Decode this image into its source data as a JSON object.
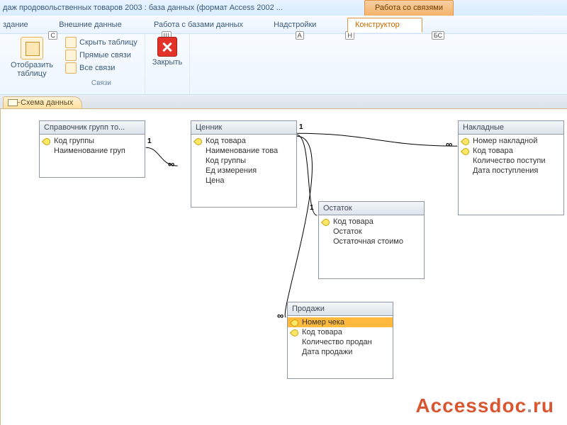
{
  "window_title": "даж продовольственных товаров 2003 : база данных (формат Access 2002 ...",
  "context_tab": "Работа со связями",
  "main_tabs": {
    "t1": "здание",
    "t2": "Внешние данные",
    "t3": "Работа с базами данных",
    "t4": "Надстройки",
    "t5": "Конструктор",
    "k1": "С",
    "k2": "Ш",
    "k3": "А",
    "k4": "Н",
    "k5": "БС"
  },
  "ribbon": {
    "show_table": "Отобразить\nтаблицу",
    "hide_table": "Скрыть таблицу",
    "direct": "Прямые связи",
    "all": "Все связи",
    "group1": "Связи",
    "close": "Закрыть"
  },
  "doc_tab": "Схема данных",
  "tables": {
    "t1": {
      "title": "Справочник групп то...",
      "f1": "Код группы",
      "f2": "Наименование груп"
    },
    "t2": {
      "title": "Ценник",
      "f1": "Код товара",
      "f2": "Наименование това",
      "f3": "Код группы",
      "f4": "Ед измерения",
      "f5": "Цена"
    },
    "t3": {
      "title": "Остаток",
      "f1": "Код товара",
      "f2": "Остаток",
      "f3": "Остаточная стоимо"
    },
    "t4": {
      "title": "Продажи",
      "f1": "Номер чека",
      "f2": "Код товара",
      "f3": "Количество продан",
      "f4": "Дата продажи"
    },
    "t5": {
      "title": "Накладные",
      "f1": "Номер накладной",
      "f2": "Код товара",
      "f3": "Количество поступи",
      "f4": "Дата поступления"
    }
  },
  "card": {
    "one": "1",
    "many": "∞"
  },
  "watermark": {
    "a": "Accessdoc",
    "b": "ru"
  }
}
